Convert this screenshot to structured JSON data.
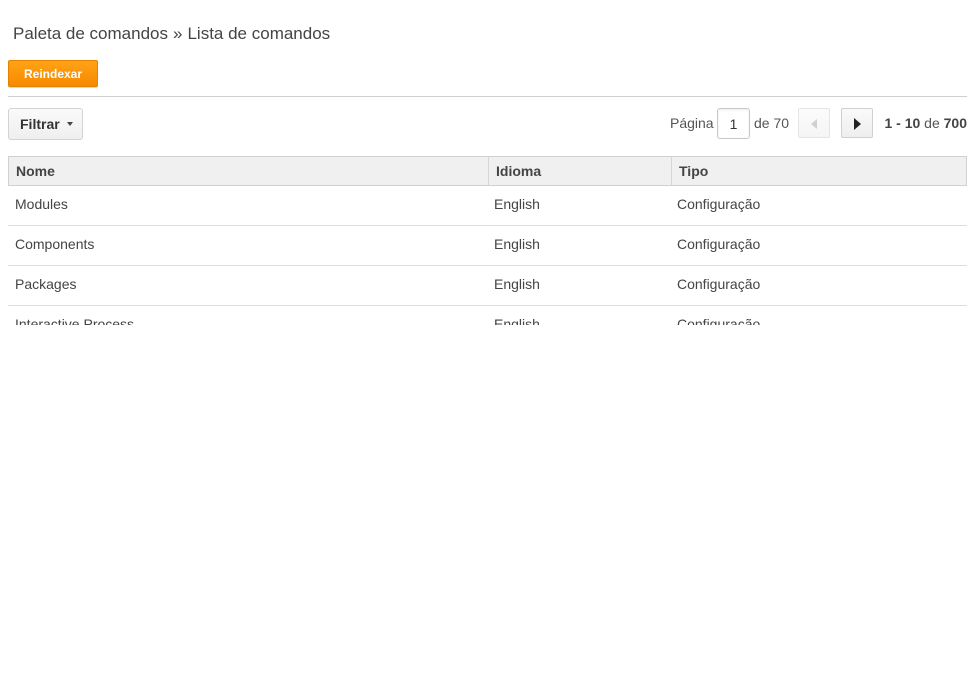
{
  "breadcrumb": {
    "parent": "Paleta de comandos",
    "separator": "»",
    "current": "Lista de comandos"
  },
  "toolbar": {
    "reindex_label": "Reindexar"
  },
  "filter": {
    "label": "Filtrar"
  },
  "pager": {
    "page_label": "Página",
    "current_page": "1",
    "of_label": "de 70",
    "range_start": "1",
    "range_dash": "-",
    "range_end": "10",
    "range_of": "de",
    "total": "700"
  },
  "table": {
    "columns": [
      "Nome",
      "Idioma",
      "Tipo"
    ],
    "rows": [
      [
        "Modules",
        "English",
        "Configuração"
      ],
      [
        "Components",
        "English",
        "Configuração"
      ],
      [
        "Packages",
        "English",
        "Configuração"
      ],
      [
        "Interactive Process",
        "English",
        "Configuração"
      ]
    ]
  },
  "colors": {
    "accent": "#ff9500",
    "header_bg": "#f0f0f0"
  }
}
